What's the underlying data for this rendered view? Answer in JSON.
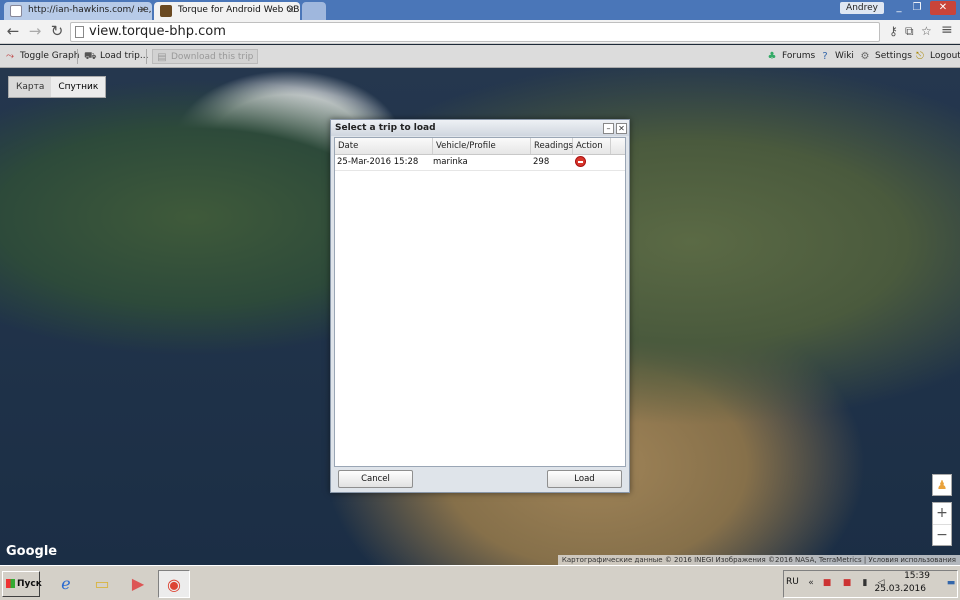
{
  "browser": {
    "tabs": [
      {
        "title": "http://ian-hawkins.com/ не,",
        "active": false
      },
      {
        "title": "Torque for Android Web OBD",
        "active": true
      }
    ],
    "user": "Andrey",
    "url": "view.torque-bhp.com"
  },
  "app_toolbar": {
    "toggle_graph": "Toggle Graph",
    "load_trip": "Load trip...",
    "download_trip": "Download this trip",
    "forums": "Forums",
    "wiki": "Wiki",
    "settings": "Settings",
    "logout": "Logout"
  },
  "map": {
    "type_map": "Карта",
    "type_satellite": "Спутник",
    "logo": "Google",
    "attribution": "Картографические данные © 2016 INEGI Изображения ©2016 NASA, TerraMetrics | Условия использования",
    "zoom_in": "+",
    "zoom_out": "−"
  },
  "dialog": {
    "title": "Select a trip to load",
    "columns": [
      "Date",
      "Vehicle/Profile",
      "Readings",
      "Action"
    ],
    "rows": [
      {
        "date": "25-Mar-2016 15:28",
        "vehicle": "marinka",
        "readings": "298"
      }
    ],
    "cancel": "Cancel",
    "load": "Load"
  },
  "taskbar": {
    "start": "Пуск",
    "lang": "RU",
    "time": "15:39",
    "date": "25.03.2016"
  },
  "colors": {
    "tabstrip": "#4a76b8",
    "delete_icon": "#d7362b"
  }
}
